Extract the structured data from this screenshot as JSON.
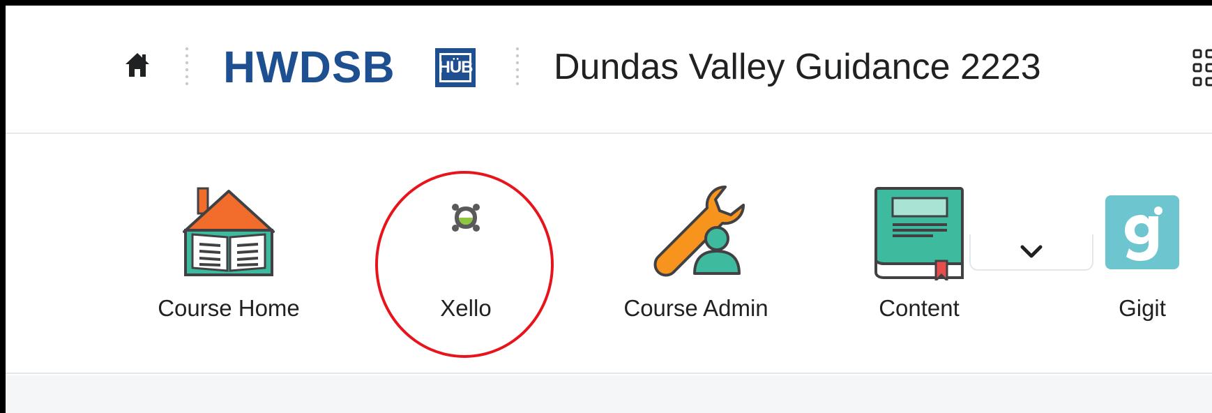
{
  "header": {
    "logo_text": "HWDSB",
    "logo_badge": "HÜB",
    "course_title": "Dundas Valley Guidance 2223",
    "home_icon": "home-icon",
    "apps_icon": "waffle-grid-icon"
  },
  "nav": {
    "items": [
      {
        "label": "Course Home",
        "icon": "course-home-icon"
      },
      {
        "label": "Xello",
        "icon": "xello-icon"
      },
      {
        "label": "Course Admin",
        "icon": "course-admin-icon"
      },
      {
        "label": "Content",
        "icon": "content-book-icon"
      },
      {
        "label": "Gigit",
        "icon": "gigit-icon"
      }
    ],
    "more_icon": "chevron-down-icon"
  },
  "colors": {
    "brand_blue": "#1d4f91",
    "highlight_red": "#e8141b",
    "house_orange": "#f26d2b",
    "teal": "#3ebb9f",
    "wrench_orange": "#f7941d",
    "gigit_teal": "#6cc5cf",
    "xello_green": "#8dc63f"
  }
}
